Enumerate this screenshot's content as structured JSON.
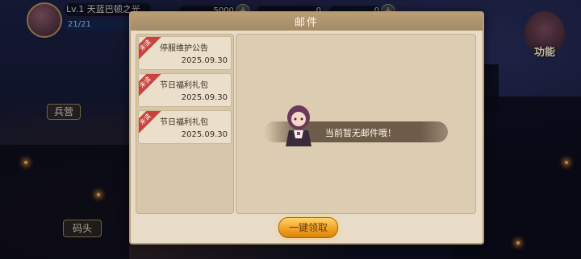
{
  "hud": {
    "level_name": "Lv.1 天蓝巴顿之光",
    "energy": "21/21",
    "gold": "5000",
    "gem": "0",
    "ticket": "0",
    "plus_label": "+"
  },
  "side": {
    "left_label": "兵营",
    "bottom_label": "码头",
    "function_label": "功能"
  },
  "dialog": {
    "title": "邮件",
    "unread_tag": "未读",
    "mails": [
      {
        "title": "停服维护公告",
        "date": "2025.09.30"
      },
      {
        "title": "节日福利礼包",
        "date": "2025.09.30"
      },
      {
        "title": "节日福利礼包",
        "date": "2025.09.30"
      }
    ],
    "empty_text": "当前暂无邮件哦！",
    "claim_all": "一键领取"
  },
  "colors": {
    "accent": "#f0a020",
    "ribbon": "#c9423e",
    "panel": "#e8dcc8"
  }
}
